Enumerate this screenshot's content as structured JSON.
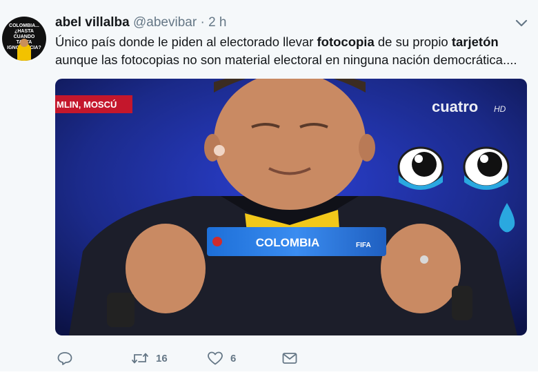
{
  "tweet": {
    "author_name": "abel villalba",
    "author_handle": "@abevibar",
    "separator": "·",
    "time": "2 h",
    "avatar_text": "COLOMBIA... ¿HASTA CUANDO TANTA IGNORANCIA?",
    "text_part1": "Único país donde le piden al electorado llevar ",
    "bold1": "fotocopia",
    "text_part2": " de su propio ",
    "bold2": "tarjetón",
    "text_part3": "aunque las fotocopias no son material electoral en ninguna nación democrática....",
    "media": {
      "location_banner": "MLIN, MOSCÚ",
      "channel_logo": "cuatro",
      "channel_suffix": "HD",
      "ticket_text": "COLOMBIA",
      "ticket_brand": "FIFA"
    },
    "actions": {
      "reply_icon": "reply-icon",
      "retweet_icon": "retweet-icon",
      "retweet_count": "16",
      "like_icon": "heart-icon",
      "like_count": "6",
      "message_icon": "envelope-icon"
    }
  },
  "colors": {
    "text": "#14171a",
    "secondary": "#657786",
    "background": "#f5f8fa",
    "stage_blue": "#1b2a8a"
  }
}
